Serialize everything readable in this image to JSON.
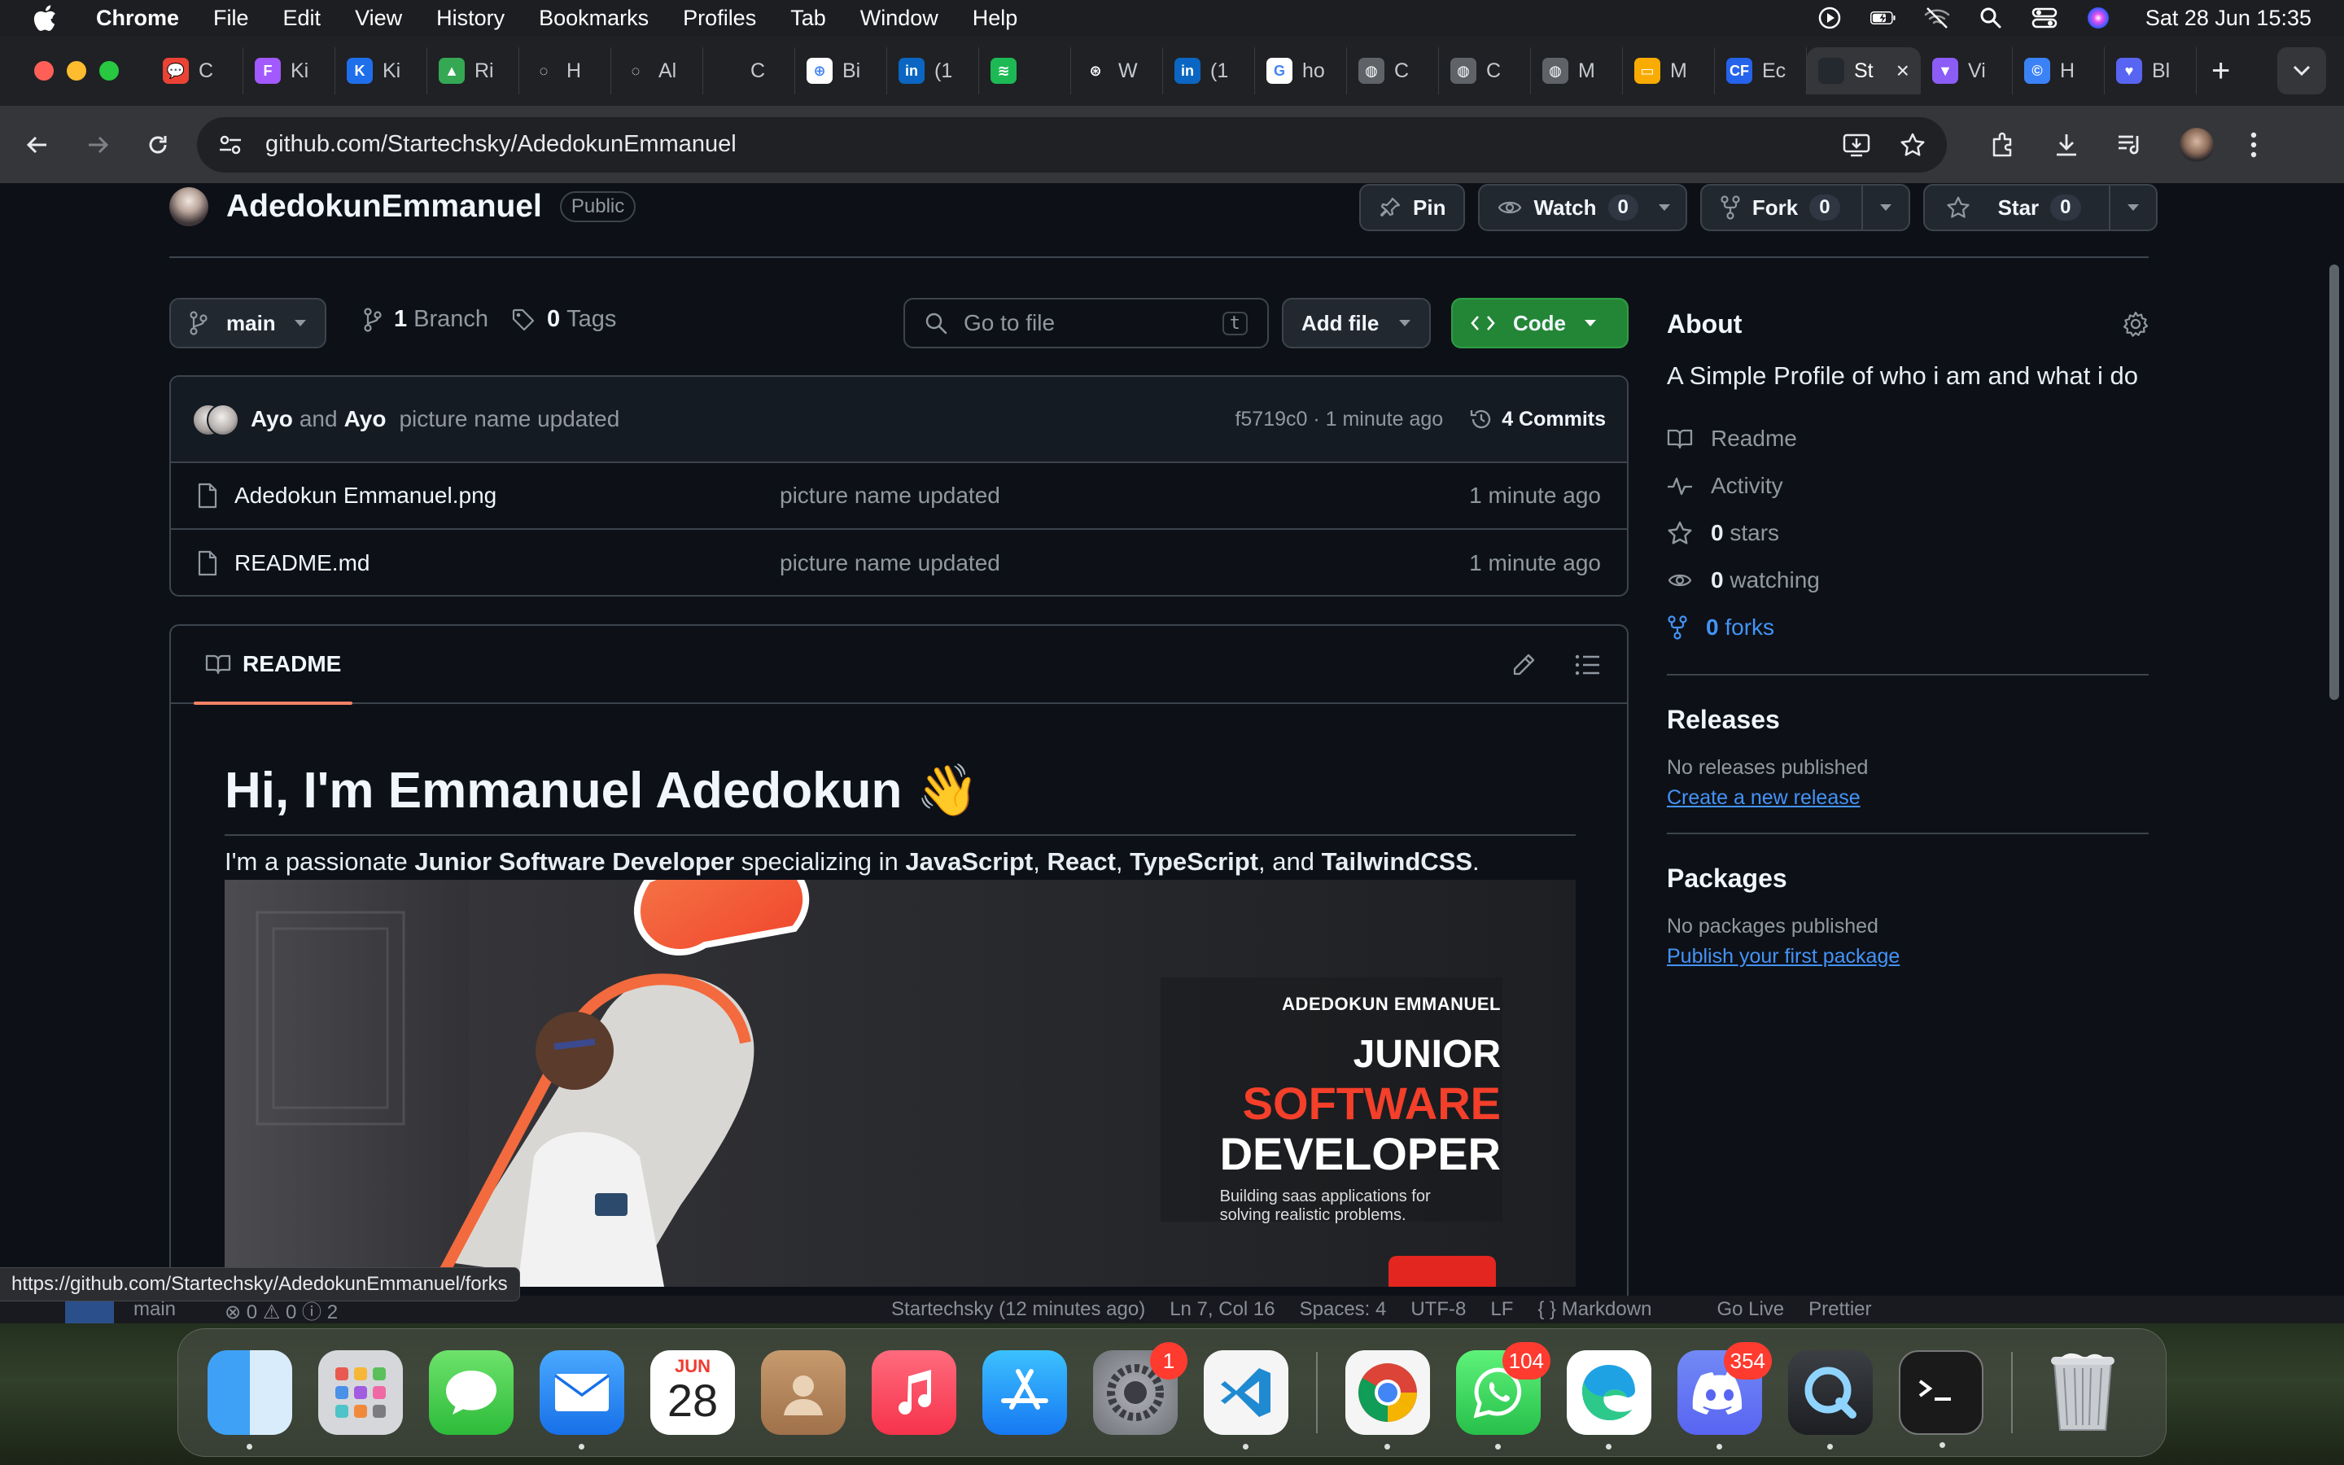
{
  "menubar": {
    "app": "Chrome",
    "items": [
      "File",
      "Edit",
      "View",
      "History",
      "Bookmarks",
      "Profiles",
      "Tab",
      "Window",
      "Help"
    ],
    "clock": "Sat 28 Jun  15:35"
  },
  "tabs": [
    {
      "label": "C",
      "color": "#ea4335",
      "glyph": "💬"
    },
    {
      "label": "Ki",
      "color": "#a259ff",
      "glyph": "F"
    },
    {
      "label": "Ki",
      "color": "#1f6feb",
      "glyph": "K"
    },
    {
      "label": "Ri",
      "color": "#34a853",
      "glyph": "▲"
    },
    {
      "label": "H",
      "color": "#202124",
      "glyph": "◌"
    },
    {
      "label": "Al",
      "color": "#202124",
      "glyph": "◌"
    },
    {
      "label": "C",
      "color": "#202124",
      "glyph": ""
    },
    {
      "label": "Bi",
      "color": "#ffffff",
      "glyph": "⊕"
    },
    {
      "label": "(1",
      "color": "#0a66c2",
      "glyph": "in"
    },
    {
      "label": "",
      "color": "#1db954",
      "glyph": "≋"
    },
    {
      "label": "W",
      "color": "#202124",
      "glyph": "⊛"
    },
    {
      "label": "(1",
      "color": "#0a66c2",
      "glyph": "in"
    },
    {
      "label": "ho",
      "color": "#ffffff",
      "glyph": "G"
    },
    {
      "label": "C",
      "color": "#5f6368",
      "glyph": "◍"
    },
    {
      "label": "C",
      "color": "#5f6368",
      "glyph": "◍"
    },
    {
      "label": "M",
      "color": "#5f6368",
      "glyph": "◍"
    },
    {
      "label": "M",
      "color": "#f9ab00",
      "glyph": "▭"
    },
    {
      "label": "Ec",
      "color": "#2563eb",
      "glyph": "CF"
    },
    {
      "label": "St",
      "color": "#24292f",
      "glyph": "",
      "active": true
    },
    {
      "label": "Vi",
      "color": "#8b5cf6",
      "glyph": "▼"
    },
    {
      "label": "H",
      "color": "#3b82f6",
      "glyph": "©"
    },
    {
      "label": "Bl",
      "color": "#5865f2",
      "glyph": "♥"
    }
  ],
  "address": {
    "url": "github.com/Startechsky/AdedokunEmmanuel"
  },
  "repo": {
    "name": "AdedokunEmmanuel",
    "visibility": "Public",
    "pin": "Pin",
    "watch": "Watch",
    "watch_count": "0",
    "fork": "Fork",
    "fork_count": "0",
    "star": "Star",
    "star_count": "0"
  },
  "branchbar": {
    "branch": "main",
    "branches_count": "1",
    "branches_label": "Branch",
    "tags_count": "0",
    "tags_label": "Tags",
    "search_placeholder": "Go to file",
    "search_key": "t",
    "add_file": "Add file",
    "code": "Code"
  },
  "commit": {
    "author1": "Ayo",
    "and": "and",
    "author2": "Ayo",
    "message": "picture name updated",
    "hash_time": "f5719c0 · 1 minute ago",
    "commits": "4 Commits"
  },
  "files": [
    {
      "name": "Adedokun Emmanuel.png",
      "message": "picture name updated",
      "time": "1 minute ago"
    },
    {
      "name": "README.md",
      "message": "picture name updated",
      "time": "1 minute ago"
    }
  ],
  "readme": {
    "tab": "README",
    "heading": "Hi, I'm Emmanuel Adedokun",
    "heading_emoji": "👋",
    "intro_1": "I'm a passionate ",
    "intro_role": "Junior Software Developer",
    "intro_2": " specializing in ",
    "intro_js": "JavaScript",
    "intro_c1": ", ",
    "intro_react": "React",
    "intro_c2": ", ",
    "intro_ts": "TypeScript",
    "intro_and": ", and ",
    "intro_tw": "TailwindCSS",
    "intro_end": "."
  },
  "banner": {
    "name": "ADEDOKUN EMMANUEL",
    "line1": "JUNIOR",
    "line2": "SOFTWARE",
    "line3": "DEVELOPER",
    "tagline1": "Building saas applications for",
    "tagline2": "solving realistic problems."
  },
  "about": {
    "title": "About",
    "description": "A Simple Profile of who i am and what i do",
    "readme": "Readme",
    "activity": "Activity",
    "stars_count": "0",
    "stars_label": "stars",
    "watching_count": "0",
    "watching_label": "watching",
    "forks_count": "0",
    "forks_label": "forks"
  },
  "releases": {
    "title": "Releases",
    "empty": "No releases published",
    "link": "Create a new release"
  },
  "packages": {
    "title": "Packages",
    "empty": "No packages published",
    "link": "Publish your first package"
  },
  "link_preview": "https://github.com/Startechsky/AdedokunEmmanuel/forks",
  "vscode_status": {
    "branch": "main",
    "problems": "⊗ 0 ⚠ 0 ⓘ 2",
    "author": "Startechsky (12 minutes ago)",
    "position": "Ln 7, Col 16",
    "spaces": "Spaces: 4",
    "encoding": "UTF-8",
    "eol": "LF",
    "language": "{ } Markdown",
    "golive": "Go Live",
    "prettier": "Prettier"
  },
  "dock": {
    "calendar_month": "JUN",
    "calendar_day": "28",
    "badges": {
      "settings": "1",
      "whatsapp": "104",
      "discord": "354"
    }
  },
  "colors": {
    "page_bg": "#0d1117",
    "border": "#3d444d",
    "code_btn": "#238636",
    "link": "#4493f8",
    "accent_red": "#f43f2a"
  }
}
